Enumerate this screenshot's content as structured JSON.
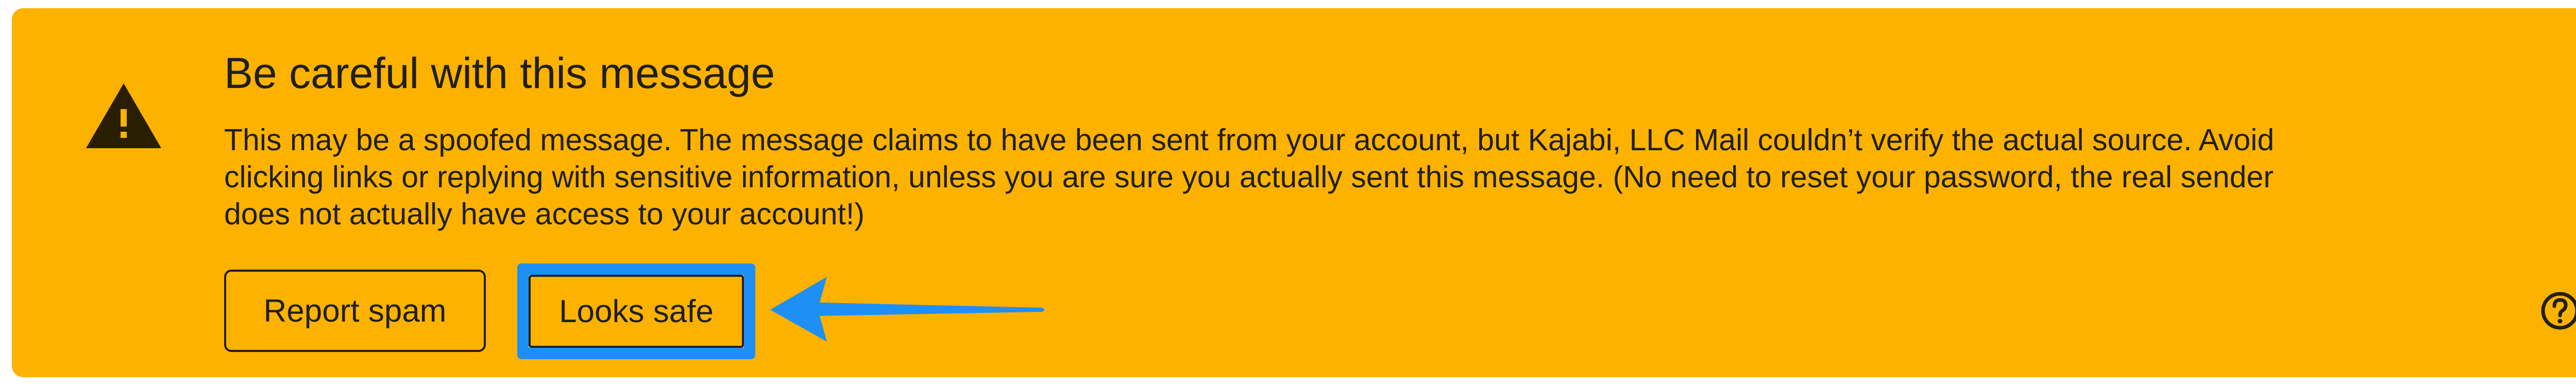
{
  "warning": {
    "title": "Be careful with this message",
    "body": "This may be a spoofed message. The message claims to have been sent from your account, but Kajabi, LLC Mail couldn’t verify the actual source. Avoid clicking links or replying with sensitive information, unless you are sure you actually sent this message. (No need to reset your password, the real sender does not actually have access to your account!)",
    "icon": "warning-triangle-icon"
  },
  "actions": {
    "report_spam_label": "Report spam",
    "looks_safe_label": "Looks safe"
  },
  "annotation": {
    "highlight_color": "#1e8ff5",
    "arrow_icon": "arrow-left-icon"
  },
  "help": {
    "icon": "help-circle-icon"
  },
  "colors": {
    "banner_background": "#fdb200",
    "text": "#1f1f1f"
  }
}
